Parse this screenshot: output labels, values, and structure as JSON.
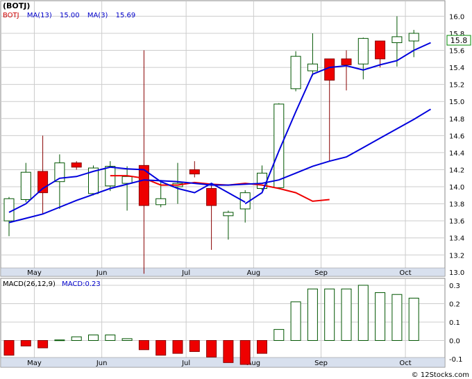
{
  "price_panel": {
    "symbol_label": "(BOTJ)",
    "legend": [
      {
        "text": "BOTJ",
        "color": "#cc0000"
      },
      {
        "text": "MA(13)",
        "color": "#0000cc"
      },
      {
        "text": "15.00",
        "color": "#0000cc"
      },
      {
        "text": "MA(3)",
        "color": "#0000cc"
      },
      {
        "text": "15.69",
        "color": "#0000cc"
      }
    ],
    "last_price_tag": "15.8"
  },
  "macd_panel": {
    "legend": [
      {
        "text": "MACD(26,12,9)",
        "color": "#000000"
      },
      {
        "text": "MACD:0.23",
        "color": "#0000cc"
      }
    ]
  },
  "x_axis": {
    "months": [
      "May",
      "Jun",
      "Jul",
      "Aug",
      "Sep",
      "Oct"
    ]
  },
  "watermark": "© 12Stocks.com",
  "colors": {
    "up_candle": "#ffffff",
    "down_candle": "#ee0000",
    "candle_outline": "#005500",
    "ma_blue": "#0000dd",
    "ma_red": "#ee0000",
    "grid": "#cccccc",
    "axis_band": "#d8e0ee",
    "macd_up": "#ffffff",
    "macd_down": "#ee0000"
  },
  "chart_data": [
    {
      "type": "candlestick",
      "title": "BOTJ",
      "ylim": [
        12.95,
        16.15
      ],
      "y_ticks": [
        13.0,
        13.2,
        13.4,
        13.6,
        13.8,
        14.0,
        14.2,
        14.4,
        14.6,
        14.8,
        15.0,
        15.2,
        15.4,
        15.6,
        15.8,
        16.0
      ],
      "month_ticks": [
        {
          "label": "May",
          "index": 1.5
        },
        {
          "label": "Jun",
          "index": 5.5
        },
        {
          "label": "Jul",
          "index": 10.5
        },
        {
          "label": "Aug",
          "index": 14.5
        },
        {
          "label": "Sep",
          "index": 18.5
        },
        {
          "label": "Oct",
          "index": 23.5
        }
      ],
      "candles": [
        {
          "open": 13.6,
          "high": 13.88,
          "low": 13.42,
          "close": 13.86
        },
        {
          "open": 13.85,
          "high": 14.28,
          "low": 13.82,
          "close": 14.17
        },
        {
          "open": 14.18,
          "high": 14.6,
          "low": 13.68,
          "close": 13.93
        },
        {
          "open": 14.06,
          "high": 14.38,
          "low": 13.74,
          "close": 14.28
        },
        {
          "open": 14.28,
          "high": 14.3,
          "low": 14.2,
          "close": 14.23
        },
        {
          "open": 13.92,
          "high": 14.25,
          "low": 13.9,
          "close": 14.22
        },
        {
          "open": 14.01,
          "high": 14.3,
          "low": 13.95,
          "close": 14.24
        },
        {
          "open": 14.04,
          "high": 14.24,
          "low": 13.72,
          "close": 14.12
        },
        {
          "open": 14.25,
          "high": 15.6,
          "low": 12.98,
          "close": 13.78
        },
        {
          "open": 13.79,
          "high": 14.08,
          "low": 13.76,
          "close": 13.86
        },
        {
          "open": 14.0,
          "high": 14.28,
          "low": 13.8,
          "close": 14.04
        },
        {
          "open": 14.2,
          "high": 14.3,
          "low": 14.11,
          "close": 14.15
        },
        {
          "open": 13.98,
          "high": 14.02,
          "low": 13.26,
          "close": 13.78
        },
        {
          "open": 13.66,
          "high": 13.72,
          "low": 13.38,
          "close": 13.7
        },
        {
          "open": 13.74,
          "high": 13.96,
          "low": 13.58,
          "close": 13.93
        },
        {
          "open": 13.98,
          "high": 14.25,
          "low": 13.96,
          "close": 14.16
        },
        {
          "open": 13.99,
          "high": 14.98,
          "low": 13.98,
          "close": 14.97
        },
        {
          "open": 15.15,
          "high": 15.59,
          "low": 15.12,
          "close": 15.53
        },
        {
          "open": 15.36,
          "high": 15.8,
          "low": 15.3,
          "close": 15.44
        },
        {
          "open": 15.5,
          "high": 15.5,
          "low": 14.3,
          "close": 15.25
        },
        {
          "open": 15.5,
          "high": 15.6,
          "low": 15.13,
          "close": 15.43
        },
        {
          "open": 15.44,
          "high": 15.75,
          "low": 15.26,
          "close": 15.74
        },
        {
          "open": 15.71,
          "high": 15.71,
          "low": 15.4,
          "close": 15.5
        },
        {
          "open": 15.69,
          "high": 16.0,
          "low": 15.41,
          "close": 15.76
        },
        {
          "open": 15.71,
          "high": 15.84,
          "low": 15.52,
          "close": 15.8
        }
      ],
      "ma_series": [
        {
          "name": "MA(13)",
          "color": "#0000dd",
          "values": [
            13.58,
            13.63,
            13.68,
            13.76,
            13.84,
            13.91,
            13.98,
            14.03,
            14.08,
            14.07,
            14.06,
            14.04,
            14.02,
            14.02,
            14.03,
            14.04,
            14.08,
            14.16,
            14.24,
            14.3,
            14.35,
            14.46,
            14.57,
            14.68,
            14.79,
            14.91
          ]
        },
        {
          "name": "MA(3)",
          "color": "#0000dd",
          "values": [
            13.7,
            13.81,
            13.96,
            14.11,
            14.12,
            14.18,
            14.2,
            14.2,
            14.15,
            14.11,
            14.11,
            14.15,
            14.14,
            14.12,
            14.08,
            14.06,
            14.03,
            14.05,
            14.1,
            14.17,
            14.24,
            14.33,
            14.42,
            14.53,
            14.64,
            14.76
          ]
        },
        {
          "name": "MA(3) trailing",
          "color": "#0000dd",
          "values": [
            null,
            null,
            null,
            null,
            null,
            null,
            null,
            null,
            null,
            null,
            null,
            null,
            null,
            null,
            13.8,
            13.93,
            14.42,
            14.88,
            15.32,
            15.4,
            15.42,
            15.37,
            15.43,
            15.48,
            15.6,
            15.69
          ]
        },
        {
          "name": "MA(3) early",
          "color": "#0000dd",
          "values": [
            13.7,
            13.8,
            13.98,
            14.1,
            14.12,
            14.18,
            14.23,
            14.21,
            14.2,
            14.06,
            13.98,
            13.93,
            14.04,
            13.93,
            13.82,
            null,
            null,
            null,
            null,
            null,
            null,
            null,
            null,
            null,
            null,
            null
          ]
        }
      ],
      "red_ma": {
        "name": "MA(13)",
        "color": "#ee0000",
        "values": [
          null,
          null,
          null,
          null,
          null,
          null,
          14.13,
          14.13,
          14.1,
          14.02,
          14.02,
          14.05,
          14.03,
          14.02,
          14.04,
          14.02,
          13.98,
          13.93,
          13.83,
          13.85,
          null,
          null,
          null,
          null,
          null
        ]
      }
    },
    {
      "type": "bar",
      "title": "MACD(26,12,9)",
      "ylim": [
        -0.13,
        0.33
      ],
      "y_ticks": [
        -0.1,
        0.0,
        0.1,
        0.2,
        0.3
      ],
      "values": [
        -0.08,
        -0.03,
        -0.04,
        0.003,
        0.02,
        0.03,
        0.03,
        0.01,
        -0.05,
        -0.08,
        -0.07,
        -0.06,
        -0.09,
        -0.12,
        -0.13,
        -0.07,
        0.06,
        0.21,
        0.28,
        0.28,
        0.28,
        0.3,
        0.26,
        0.25,
        0.23
      ]
    }
  ]
}
